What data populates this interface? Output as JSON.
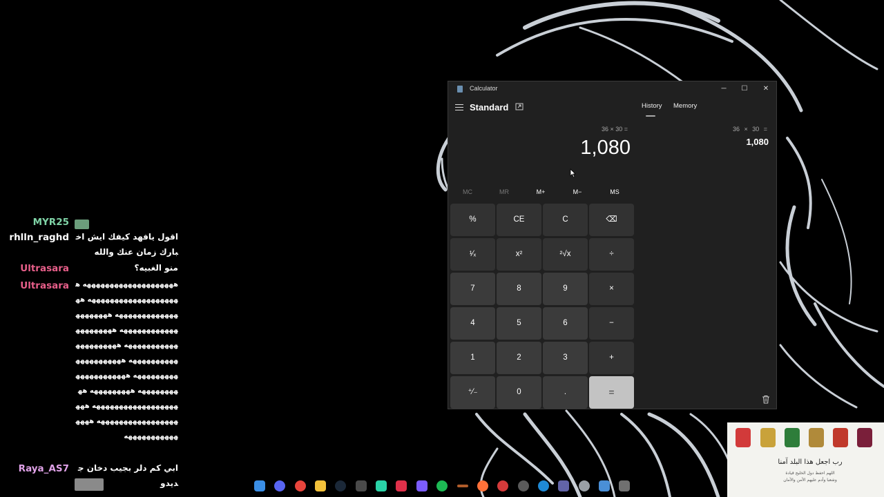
{
  "chat": {
    "messages": [
      {
        "user": "MYR25",
        "user_color": "#7fd3a6",
        "message": ""
      },
      {
        "user": "rhlln_raghd",
        "user_color": "#ffffff",
        "message": "اقول يافهد كيفك ايش اخبارك زمان عنك والله"
      },
      {
        "user": "Ultrasara",
        "user_color": "#e85f8a",
        "message": "منو الغبيه؟"
      },
      {
        "user": "Ultrasara",
        "user_color": "#e85f8a",
        "message": "ههههههههههههههههههههه ههههههههههههههههههههه هههههههههههههههه ههههههههههههههههههههه ههههههههههههههههههههه ههههههههههههههههههههه ههههههههههههههههههههه ههههههههههههههههههههه هههههههههه ههههههههههههههههههههه ههههههههههههههههههههه هههههههههههههههه"
      },
      {
        "user": "Raya_AS7",
        "user_color": "#e0a2e8",
        "message": "ابي كم دلر بجيب دخان جديدو"
      }
    ]
  },
  "calculator": {
    "window_title": "Calculator",
    "mode": "Standard",
    "tabs": [
      "History",
      "Memory"
    ],
    "active_tab": "History",
    "expression": "36 × 30 =",
    "result": "1,080",
    "history": [
      {
        "expression": "36 × 30 =",
        "result": "1,080"
      }
    ],
    "memory_buttons": [
      "MC",
      "MR",
      "M+",
      "M−",
      "MS"
    ],
    "keys": [
      [
        "%",
        "CE",
        "C",
        "⌫"
      ],
      [
        "¹⁄ₓ",
        "x²",
        "²√x",
        "÷"
      ],
      [
        "7",
        "8",
        "9",
        "×"
      ],
      [
        "4",
        "5",
        "6",
        "−"
      ],
      [
        "1",
        "2",
        "3",
        "+"
      ],
      [
        "⁺⁄₋",
        "0",
        ".",
        "="
      ]
    ],
    "window_buttons": [
      "─",
      "☐",
      "✕"
    ]
  },
  "taskbar": {
    "icons": [
      "start-icon",
      "discord-icon",
      "chrome-icon",
      "file-explorer-icon",
      "steam-icon",
      "xbox-icon",
      "app-icon",
      "adobe-icon",
      "media-icon",
      "spotify-icon",
      "tool-icon",
      "firefox-icon",
      "app-red-icon",
      "obs-icon",
      "edge-icon",
      "teams-icon",
      "settings-icon",
      "app-blue-icon",
      "calculator-icon"
    ],
    "colors": [
      "#3a8ee6",
      "#5865f2",
      "#e8453c",
      "#f3c13a",
      "#1b2838",
      "#4a4a4a",
      "#2ad3a8",
      "#e0304a",
      "#7b5cff",
      "#1db954",
      "#b05c2a",
      "#ff7139",
      "#d43a3a",
      "#5a5a5a",
      "#1f8ad6",
      "#6264a7",
      "#9aa0a6",
      "#4a8fd6",
      "#707070"
    ]
  },
  "banner": {
    "line1": "رب اجعل هذا البلد آمنا",
    "line2": "اللهم احفظ دول الخليج قيادة",
    "line3": "وشعبا وأدم عليهم الأمن والأمان"
  }
}
